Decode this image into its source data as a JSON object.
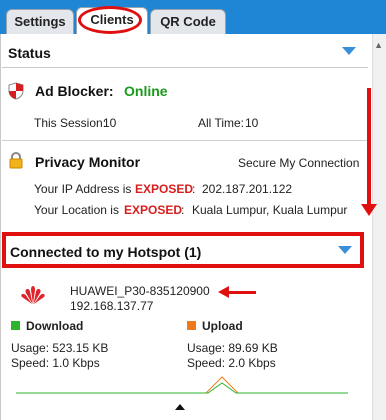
{
  "tabs": [
    {
      "label": "Settings"
    },
    {
      "label": "Clients"
    },
    {
      "label": "QR Code"
    }
  ],
  "status": {
    "title": "Status"
  },
  "ad_blocker": {
    "label": "Ad Blocker:",
    "state": "Online",
    "this_session_label": "This Session:",
    "this_session_value": "10",
    "all_time_label": "All Time:",
    "all_time_value": "10"
  },
  "privacy": {
    "title": "Privacy Monitor",
    "secure_link": "Secure My Connection",
    "ip_label": "Your IP Address is",
    "ip_status": "EXPOSED",
    "ip_value": "202.187.201.122",
    "location_label": "Your Location is",
    "location_status": "EXPOSED",
    "location_value": "Kuala Lumpur, Kuala Lumpur",
    "separator": ":"
  },
  "hotspot": {
    "title": "Connected to my Hotspot (1)"
  },
  "device": {
    "name": "HUAWEI_P30-835120900",
    "ip": "192.168.137.77",
    "download_label": "Download",
    "download_usage": "Usage: 523.15 KB",
    "download_speed": "Speed: 1.0 Kbps",
    "upload_label": "Upload",
    "upload_usage": "Usage: 89.69 KB",
    "upload_speed": "Speed: 2.0 Kbps"
  },
  "colors": {
    "tab_bar": "#1f86d6",
    "online": "#1a9a1a",
    "exposed": "#d61e1e",
    "download": "#2bb52b",
    "upload": "#f07a1a",
    "annotation": "#e01010"
  },
  "icons": {
    "ad_blocker": "shield-icon",
    "privacy": "lock-icon",
    "device": "huawei-logo-icon"
  }
}
